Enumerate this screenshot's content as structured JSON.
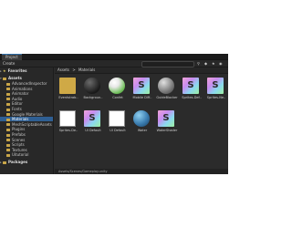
{
  "window": {
    "tab_label": "Project"
  },
  "toolbar": {
    "create_label": "Create",
    "search_placeholder": ""
  },
  "sidebar": {
    "favorites_label": "Favorites",
    "assets_label": "Assets",
    "items": [
      "AdvancedInspector",
      "Animations",
      "Animator",
      "Audio",
      "Editor",
      "Fonts",
      "Google Materials",
      "Materials",
      "MeshScriptableAssets",
      "Plugins",
      "Prefabs",
      "Scenes",
      "Scripts",
      "Textures",
      "Uitutorial"
    ],
    "packages_label": "Packages"
  },
  "breadcrumb": {
    "root": "Assets",
    "separator": ">",
    "current": "Materials"
  },
  "grid_items": [
    {
      "label": "Eventstrab..",
      "kind": "folder"
    },
    {
      "label": "Backgroun..",
      "kind": "sphere-dark"
    },
    {
      "label": "Confet",
      "kind": "sphere-green"
    },
    {
      "label": "Mobile Diff..",
      "kind": "shader"
    },
    {
      "label": "GuideBlocker",
      "kind": "sphere-grey"
    },
    {
      "label": "Sprites-Def..",
      "kind": "shader"
    },
    {
      "label": "Sprites-Ne..",
      "kind": "shader"
    },
    {
      "label": "Sprites-De..",
      "kind": "white"
    },
    {
      "label": "UI Default",
      "kind": "shader"
    },
    {
      "label": "UI Default",
      "kind": "white"
    },
    {
      "label": "Water",
      "kind": "sphere-blue"
    },
    {
      "label": "WaterShader",
      "kind": "shader"
    }
  ],
  "status": {
    "path": "Assets/Scenes/Gameplay.unity"
  },
  "icons": {
    "shader_letter": "S"
  }
}
